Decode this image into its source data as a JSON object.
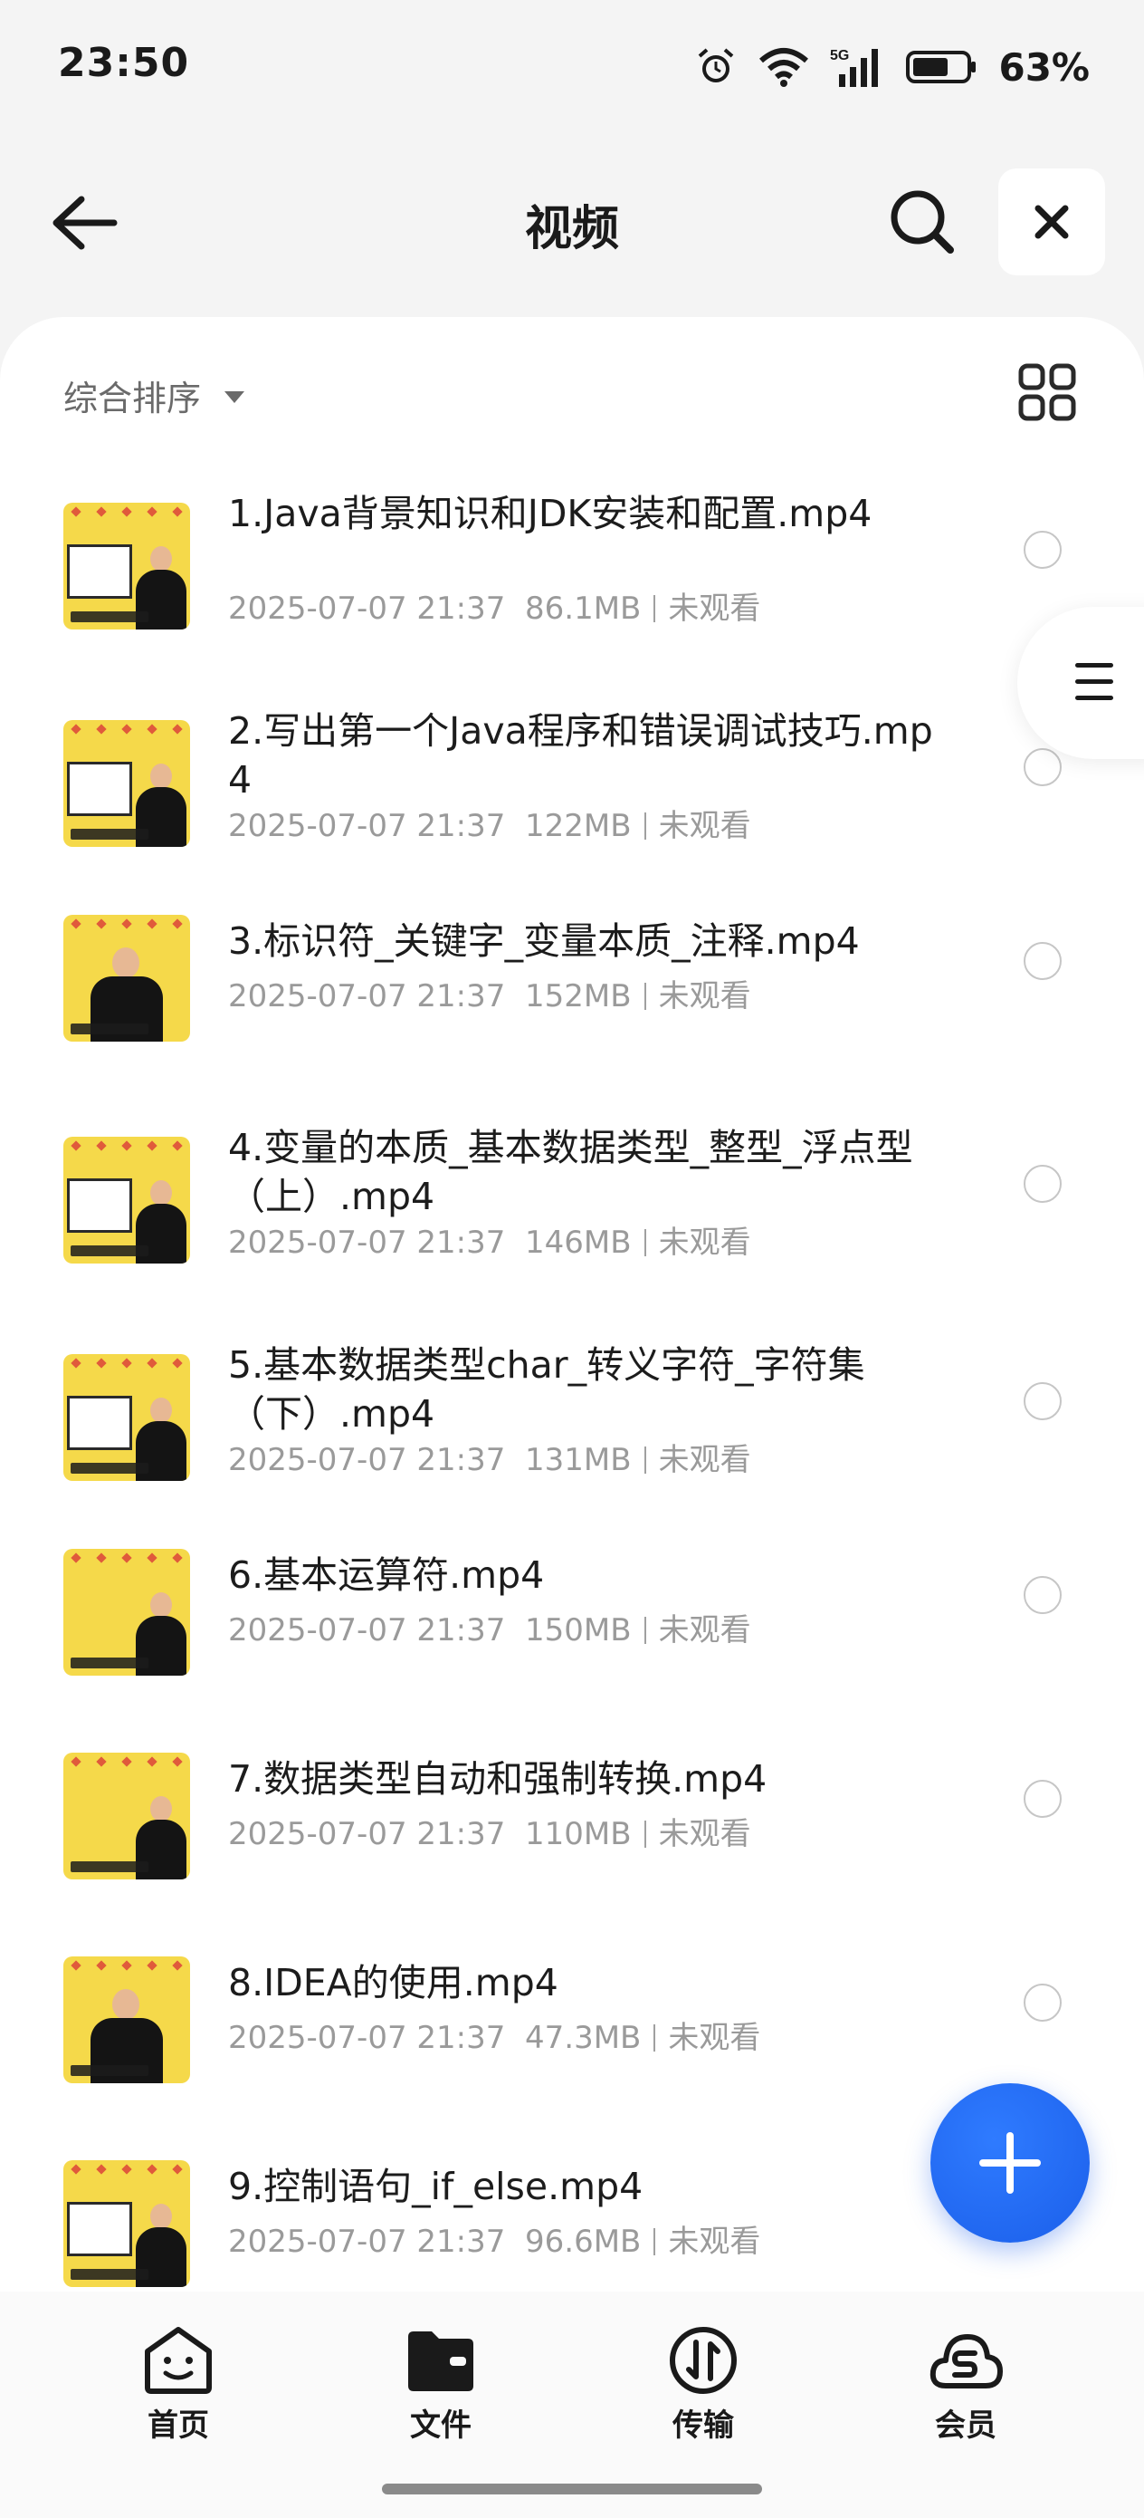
{
  "status_bar": {
    "time": "23:50",
    "network": "5G",
    "battery": "63%"
  },
  "header": {
    "title": "视频"
  },
  "sort": {
    "label": "综合排序"
  },
  "files": [
    {
      "name": "1.Java背景知识和JDK安装和配置.mp4",
      "date": "2025-07-07 21:37",
      "size": "86.1MB",
      "status": "未观看",
      "thumb": "board"
    },
    {
      "name": "2.写出第一个Java程序和错误调试技巧.mp4",
      "date": "2025-07-07 21:37",
      "size": "122MB",
      "status": "未观看",
      "thumb": "board"
    },
    {
      "name": "3.标识符_关键字_变量本质_注释.mp4",
      "date": "2025-07-07 21:37",
      "size": "152MB",
      "status": "未观看",
      "thumb": "center"
    },
    {
      "name": "4.变量的本质_基本数据类型_整型_浮点型（上）.mp4",
      "date": "2025-07-07 21:37",
      "size": "146MB",
      "status": "未观看",
      "thumb": "board"
    },
    {
      "name": "5.基本数据类型char_转义字符_字符集（下）.mp4",
      "date": "2025-07-07 21:37",
      "size": "131MB",
      "status": "未观看",
      "thumb": "board"
    },
    {
      "name": "6.基本运算符.mp4",
      "date": "2025-07-07 21:37",
      "size": "150MB",
      "status": "未观看",
      "thumb": "side"
    },
    {
      "name": "7.数据类型自动和强制转换.mp4",
      "date": "2025-07-07 21:37",
      "size": "110MB",
      "status": "未观看",
      "thumb": "side"
    },
    {
      "name": "8.IDEA的使用.mp4",
      "date": "2025-07-07 21:37",
      "size": "47.3MB",
      "status": "未观看",
      "thumb": "center"
    },
    {
      "name": "9.控制语句_if_else.mp4",
      "date": "2025-07-07 21:37",
      "size": "96.6MB",
      "status": "未观看",
      "thumb": "board"
    }
  ],
  "bottom_nav": [
    {
      "label": "首页",
      "icon": "home-face-icon"
    },
    {
      "label": "文件",
      "icon": "folder-icon"
    },
    {
      "label": "传输",
      "icon": "transfer-icon"
    },
    {
      "label": "会员",
      "icon": "vip-cloud-icon"
    }
  ],
  "colors": {
    "accent": "#1b5fea",
    "thumbnail_bg": "#f5d94a"
  }
}
